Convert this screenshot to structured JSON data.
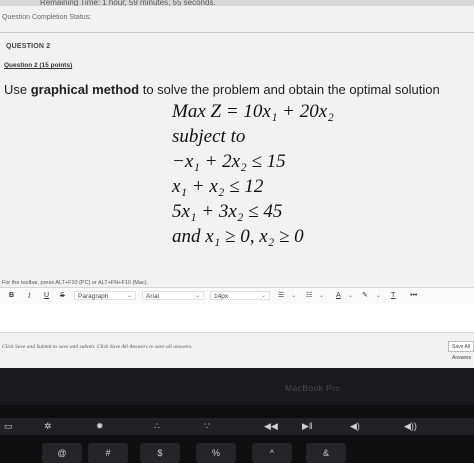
{
  "timer": {
    "text": "Remaining Time: 1 hour, 59 minutes, 55 seconds."
  },
  "completion_label": "Question Completion Status:",
  "question": {
    "tab": "QUESTION 2",
    "points": "Question 2 (15 points)",
    "prompt_prefix": "Use ",
    "prompt_bold": "graphical method",
    "prompt_suffix": " to solve the problem and obtain the optimal solution"
  },
  "math_lines": [
    "Max  Z = 10x₁ + 20x₂",
    "subject to",
    "−x₁ + 2x₂ ≤ 15",
    "x₁ + x₂ ≤ 12",
    "5x₁ + 3x₂ ≤ 45",
    "and  x₁ ≥ 0, x₂ ≥ 0"
  ],
  "toolbar": {
    "hint": "For the toolbar, press ALT+F10 (PC) or ALT+FN+F10 (Mac).",
    "bold": "B",
    "italic": "I",
    "underline": "U",
    "strike": "S",
    "paragraph": "Paragraph",
    "font": "Arial",
    "size": "14px",
    "clear": "T",
    "more": "•••"
  },
  "footer": {
    "text": "Click Save and Submit to save and submit. Click Save All Answers to save all answers.",
    "save_all": "Save All Answers"
  },
  "bezel": {
    "brand": "MacBook Pro"
  },
  "keys": {
    "k1": "@",
    "k2": "#",
    "k3": "$",
    "k4": "%",
    "k5": "^",
    "k6": "&"
  }
}
